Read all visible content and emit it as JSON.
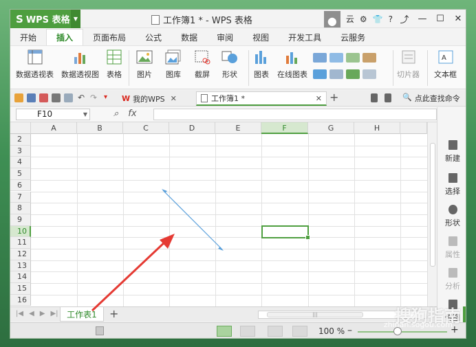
{
  "app": {
    "name": "WPS 表格",
    "title": "工作簿1 * - WPS 表格",
    "user": "云",
    "help": "?"
  },
  "tabs": [
    "开始",
    "插入",
    "页面布局",
    "公式",
    "数据",
    "审阅",
    "视图",
    "开发工具",
    "云服务"
  ],
  "active_tab": "插入",
  "ribbon": {
    "pivot_table": "数据透视表",
    "pivot_chart": "数据透视图",
    "table": "表格",
    "picture": "图片",
    "gallery": "图库",
    "screenshot": "截屏",
    "shape": "形状",
    "chart": "图表",
    "online_chart": "在线图表",
    "slicer": "切片器",
    "textbox": "文本框"
  },
  "doc_tabs": {
    "mywps": "我的WPS",
    "workbook": "工作簿1 *",
    "search": "点此查找命令"
  },
  "formula_bar": {
    "name_box": "F10",
    "fx": "fx"
  },
  "columns": [
    "A",
    "B",
    "C",
    "D",
    "E",
    "F",
    "G",
    "H"
  ],
  "selected_column": "F",
  "rows": [
    "2",
    "3",
    "4",
    "5",
    "6",
    "7",
    "8",
    "9",
    "10",
    "11",
    "12",
    "13",
    "14",
    "15",
    "16"
  ],
  "selected_row": "10",
  "side_panel": [
    "新建",
    "选择",
    "形状",
    "属性",
    "分析",
    "传图"
  ],
  "sheet": {
    "name": "工作表1",
    "add": "+"
  },
  "status": {
    "zoom": "100 %"
  },
  "colors": {
    "accent": "#4e9e3f",
    "arrow_red": "#e53a33",
    "line_blue": "#5aa0db"
  },
  "watermark": {
    "logo": "搜狗指南",
    "url": "zhinan.sogou.com"
  }
}
